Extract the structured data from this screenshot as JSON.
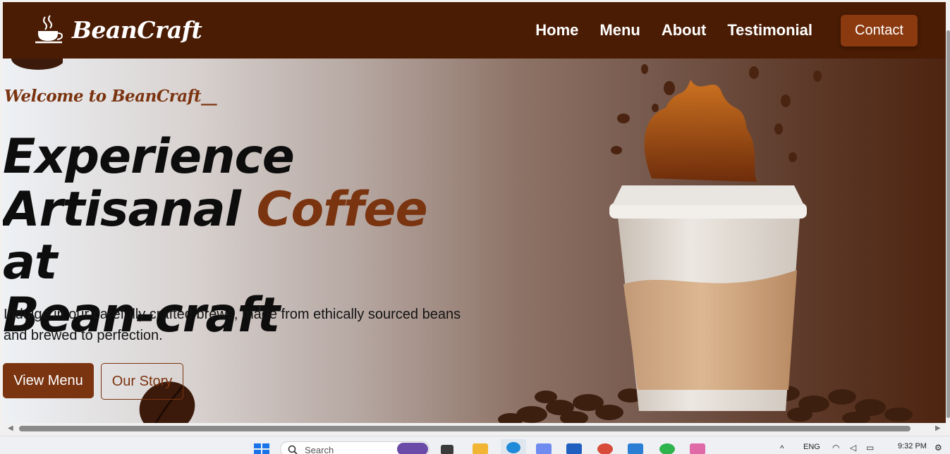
{
  "brand": {
    "name": "BeanCraft",
    "color": "#4a1c04",
    "accent": "#7b3410"
  },
  "nav": {
    "items": [
      {
        "label": "Home"
      },
      {
        "label": "Menu"
      },
      {
        "label": "About"
      },
      {
        "label": "Testimonial"
      }
    ],
    "contact_label": "Contact"
  },
  "hero": {
    "welcome": "Welcome to BeanCraft__",
    "headline_line1": "Experience",
    "headline_line2_a": "Artisanal ",
    "headline_line2_accent": "Coffee",
    "headline_line2_b": " at",
    "headline_line3": "Bean-craft",
    "subtext": "Indulge in our carefully crafted brews, made from ethically sourced beans and brewed to perfection.",
    "primary_button": "View Menu",
    "secondary_button": "Our Story",
    "image_subject": "coffee-cup-splash"
  },
  "taskbar": {
    "search_placeholder": "Search",
    "language": "ENG",
    "time": "9:32 PM",
    "icons": [
      "windows-start-icon",
      "task-view-icon",
      "file-explorer-icon",
      "edge-icon",
      "copilot-icon",
      "store-icon",
      "chrome-icon",
      "vscode-icon",
      "whatsapp-icon",
      "paint-icon"
    ]
  }
}
